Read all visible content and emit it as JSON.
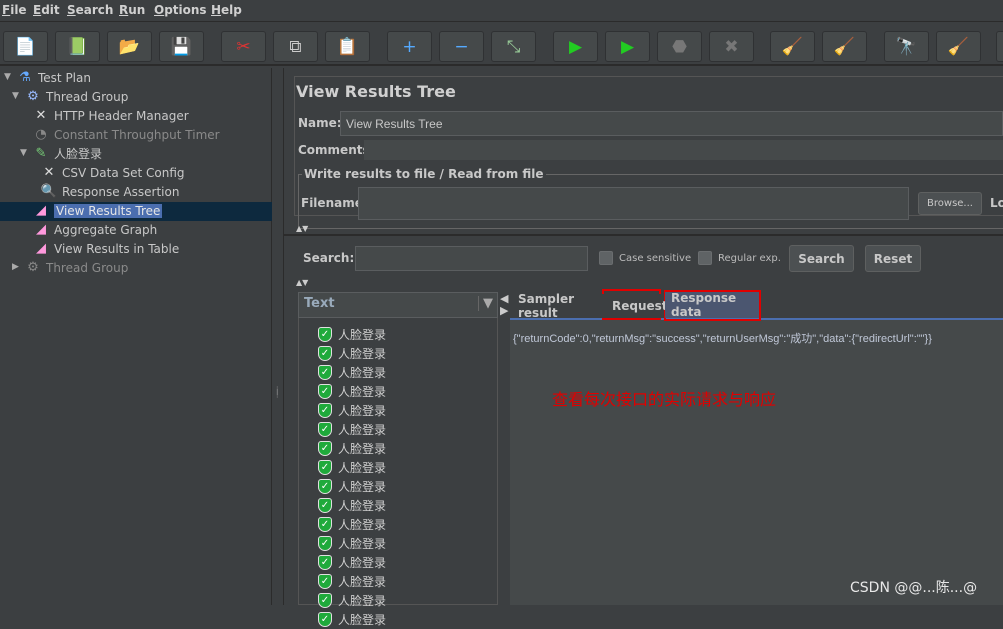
{
  "menu": [
    "File",
    "Edit",
    "Search",
    "Run",
    "Options",
    "Help"
  ],
  "toolbar": [
    {
      "name": "new-icon",
      "glyph": "📄"
    },
    {
      "name": "templates-icon",
      "glyph": "📗"
    },
    {
      "name": "open-icon",
      "glyph": "📂"
    },
    {
      "name": "save-icon",
      "glyph": "💾"
    },
    {
      "name": "cut-icon",
      "glyph": "✂"
    },
    {
      "name": "copy-icon",
      "glyph": "⧉"
    },
    {
      "name": "paste-icon",
      "glyph": "📋"
    },
    {
      "name": "expand-icon",
      "glyph": "+"
    },
    {
      "name": "collapse-icon",
      "glyph": "−"
    },
    {
      "name": "toggle-icon",
      "glyph": "⤡"
    },
    {
      "name": "start-icon",
      "glyph": "▶"
    },
    {
      "name": "start-no-pauses-icon",
      "glyph": "▶"
    },
    {
      "name": "stop-icon",
      "glyph": "⬣"
    },
    {
      "name": "shutdown-icon",
      "glyph": "✖"
    },
    {
      "name": "clear-icon",
      "glyph": "🧹"
    },
    {
      "name": "clear-all-icon",
      "glyph": "🧹"
    },
    {
      "name": "search-binoculars-icon",
      "glyph": "🔭"
    },
    {
      "name": "reset-search-icon",
      "glyph": "🧹"
    },
    {
      "name": "more-icon",
      "glyph": ""
    }
  ],
  "tree": [
    {
      "label": "Test Plan",
      "icon": "flask-icon",
      "glyph": "⚗"
    },
    {
      "label": "Thread Group",
      "icon": "gear-icon",
      "glyph": "⚙"
    },
    {
      "label": "HTTP Header Manager",
      "icon": "wrench-icon",
      "glyph": "✕"
    },
    {
      "label": "Constant Throughput Timer",
      "icon": "timer-icon",
      "glyph": "◔"
    },
    {
      "label": "人脸登录",
      "icon": "pipette-icon",
      "glyph": "✎"
    },
    {
      "label": "CSV Data Set Config",
      "icon": "wrench-icon",
      "glyph": "✕"
    },
    {
      "label": "Response Assertion",
      "icon": "magnifier-icon",
      "glyph": "🔍"
    },
    {
      "label": "View Results Tree",
      "icon": "graph-icon",
      "glyph": "◢"
    },
    {
      "label": "Aggregate Graph",
      "icon": "graph-icon",
      "glyph": "◢"
    },
    {
      "label": "View Results in Table",
      "icon": "graph-icon",
      "glyph": "◢"
    },
    {
      "label": "Thread Group",
      "icon": "gear-icon",
      "glyph": "⚙"
    }
  ],
  "panel": {
    "title": "View Results Tree",
    "name_label": "Name:",
    "name_value": "View Results Tree",
    "comments_label": "Comments:",
    "file_section": "Write results to file / Read from file",
    "filename_label": "Filename",
    "browse": "Browse...",
    "log_partial": "Lo",
    "search_label": "Search:",
    "case_sensitive": "Case sensitive",
    "regular_exp": "Regular exp.",
    "search_btn": "Search",
    "reset_btn": "Reset",
    "renderer": "Text",
    "tabs": [
      "Sampler result",
      "Request",
      "Response data"
    ],
    "response": "{\"returnCode\":0,\"returnMsg\":\"success\",\"returnUserMsg\":\"成功\",\"data\":{\"redirectUrl\":\"\"}}",
    "annotation": "查看每次接口的实际请求与响应",
    "result_label": "人脸登录"
  },
  "watermark": "CSDN @@...陈...@",
  "colors": {
    "bg": "#3c3f41",
    "selection": "#4b6eaf",
    "annotation": "#e00000",
    "success": "#1faa3b"
  }
}
